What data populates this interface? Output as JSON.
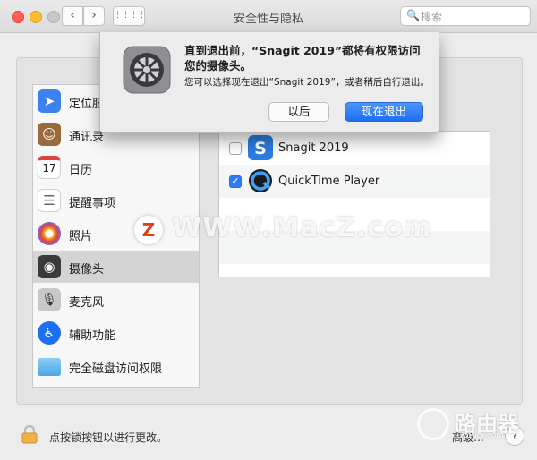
{
  "window": {
    "title": "安全性与隐私",
    "back_glyph": "‹",
    "forward_glyph": "›",
    "grid_glyph": "⋮⋮⋮⋮",
    "search_placeholder": "搜索"
  },
  "dialog": {
    "title": "直到退出前，“Snagit 2019”都将有权限访问您的摄像头。",
    "message": "您可以选择现在退出“Snagit 2019”，或者稍后自行退出。",
    "later_label": "以后",
    "quit_label": "现在退出"
  },
  "sidebar": {
    "items": [
      {
        "label": "定位服务",
        "icon": "location-arrow-icon",
        "color": "#3b82f0",
        "glyph": "➤"
      },
      {
        "label": "通讯录",
        "icon": "contacts-book-icon",
        "color": "#9a6a3c",
        "glyph": "☺"
      },
      {
        "label": "日历",
        "icon": "calendar-icon",
        "color": "#ffffff",
        "glyph": "17"
      },
      {
        "label": "提醒事项",
        "icon": "reminders-icon",
        "color": "#ffffff",
        "glyph": "☰"
      },
      {
        "label": "照片",
        "icon": "photos-icon",
        "color": "#f5a623",
        "glyph": "✿"
      },
      {
        "label": "摄像头",
        "icon": "camera-icon",
        "color": "#3a3a3a",
        "glyph": "◉"
      },
      {
        "label": "麦克风",
        "icon": "microphone-icon",
        "color": "#9a9a9a",
        "glyph": "🎙"
      },
      {
        "label": "辅助功能",
        "icon": "accessibility-icon",
        "color": "#1e6ff0",
        "glyph": "♿"
      },
      {
        "label": "完全磁盘访问权限",
        "icon": "folder-icon",
        "color": "#5ab4f0",
        "glyph": ""
      }
    ],
    "selected_index": 5
  },
  "apps": [
    {
      "name": "Snagit 2019",
      "checked": false,
      "icon": "snagit-icon"
    },
    {
      "name": "QuickTime Player",
      "checked": true,
      "icon": "quicktime-icon"
    }
  ],
  "footer": {
    "lock_text": "点按锁按钮以进行更改。",
    "advanced_label": "高级…",
    "help_label": "?"
  },
  "watermark": {
    "main": "WWW.MacZ.com",
    "logo_letter": "Z",
    "corner_text": "路由器",
    "corner_url": "luyouqi.com"
  }
}
